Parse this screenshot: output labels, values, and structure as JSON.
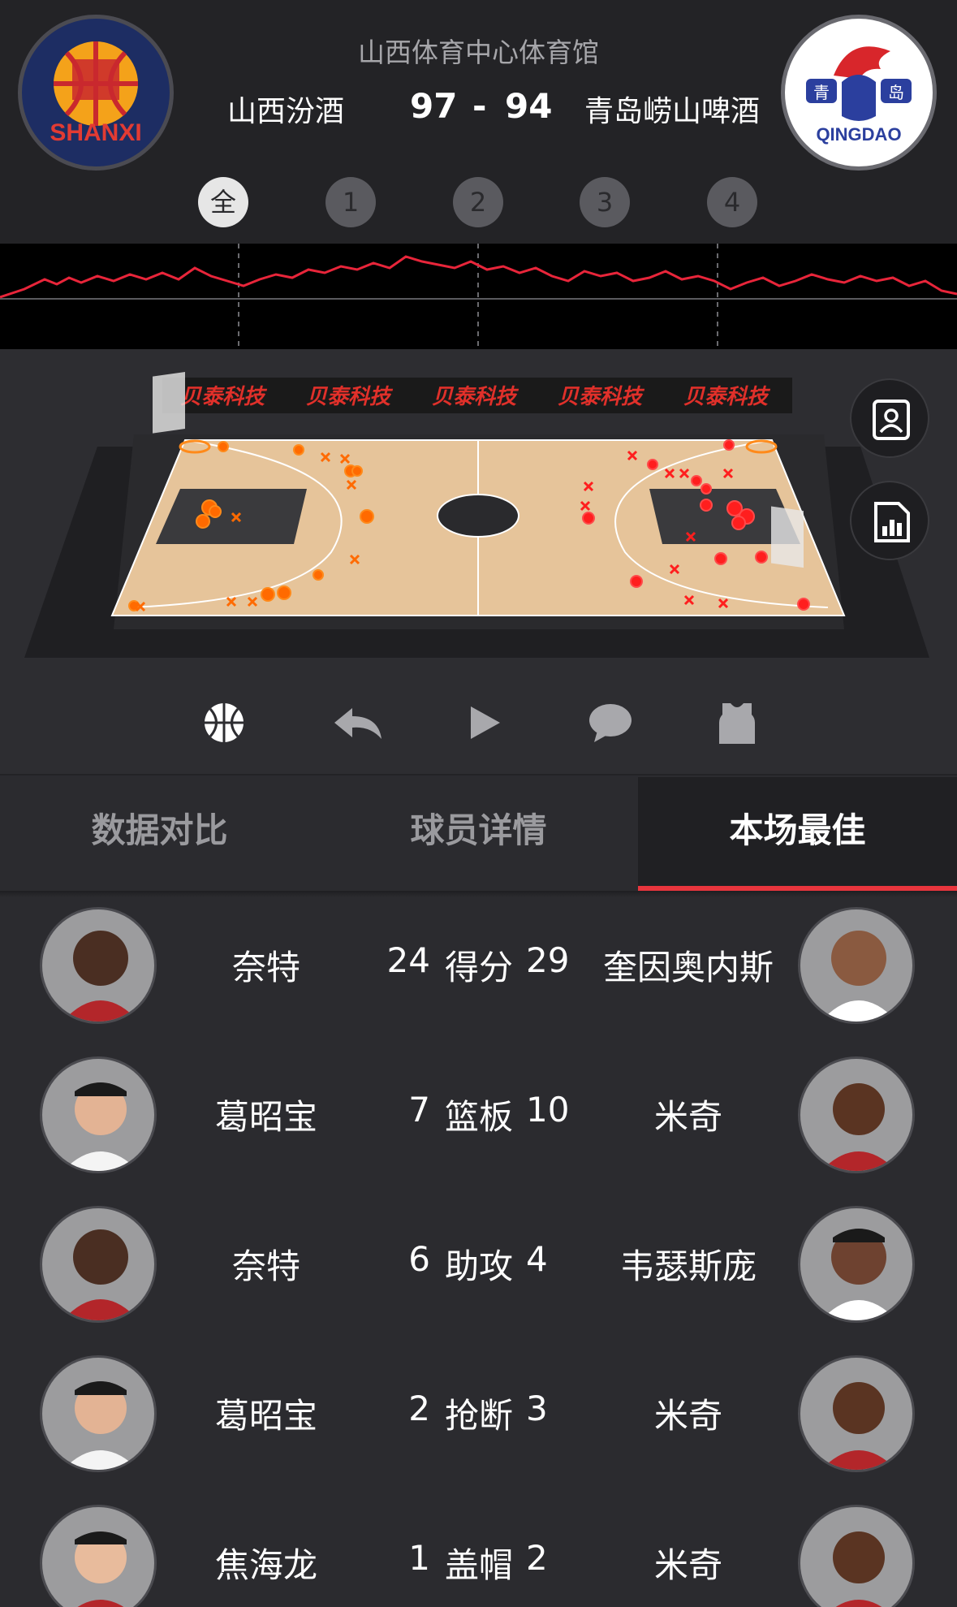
{
  "game": {
    "venue": "山西体育中心体育馆",
    "home": {
      "name": "山西汾酒",
      "score": "97",
      "logo_text": "SHANXI",
      "logo_icon": "shanxi-logo"
    },
    "away": {
      "name": "青岛崂山啤酒",
      "score": "94",
      "logo_text": "QINGDAO",
      "logo_cn_left": "青",
      "logo_cn_right": "岛",
      "logo_icon": "qingdao-eagle-logo"
    },
    "score_separator": "-"
  },
  "periods": [
    {
      "label": "全",
      "active": true
    },
    {
      "label": "1",
      "active": false
    },
    {
      "label": "2",
      "active": false
    },
    {
      "label": "3",
      "active": false
    },
    {
      "label": "4",
      "active": false
    }
  ],
  "court": {
    "banner_text": [
      "贝泰科技",
      "贝泰科技",
      "贝泰科技",
      "贝泰科技",
      "贝泰科技"
    ],
    "side_buttons": [
      "player-card-icon",
      "stats-report-icon"
    ],
    "colors": {
      "home_shot": "#ff6a00",
      "away_shot": "#ff1e1e",
      "floor": "#e9c9a0"
    }
  },
  "controls": [
    "basketball-icon",
    "replay-icon",
    "play-icon",
    "comment-icon",
    "jersey-icon"
  ],
  "tabs": [
    {
      "label": "数据对比",
      "active": false
    },
    {
      "label": "球员详情",
      "active": false
    },
    {
      "label": "本场最佳",
      "active": true
    }
  ],
  "best_players": [
    {
      "stat": "得分",
      "home_player": "奈特",
      "home_value": "24",
      "away_value": "29",
      "away_player": "奎因奥内斯"
    },
    {
      "stat": "篮板",
      "home_player": "葛昭宝",
      "home_value": "7",
      "away_value": "10",
      "away_player": "米奇"
    },
    {
      "stat": "助攻",
      "home_player": "奈特",
      "home_value": "6",
      "away_value": "4",
      "away_player": "韦瑟斯庞"
    },
    {
      "stat": "抢断",
      "home_player": "葛昭宝",
      "home_value": "2",
      "away_value": "3",
      "away_player": "米奇"
    },
    {
      "stat": "盖帽",
      "home_player": "焦海龙",
      "home_value": "1",
      "away_value": "2",
      "away_player": "米奇"
    }
  ],
  "accent_color": "#e8353d"
}
